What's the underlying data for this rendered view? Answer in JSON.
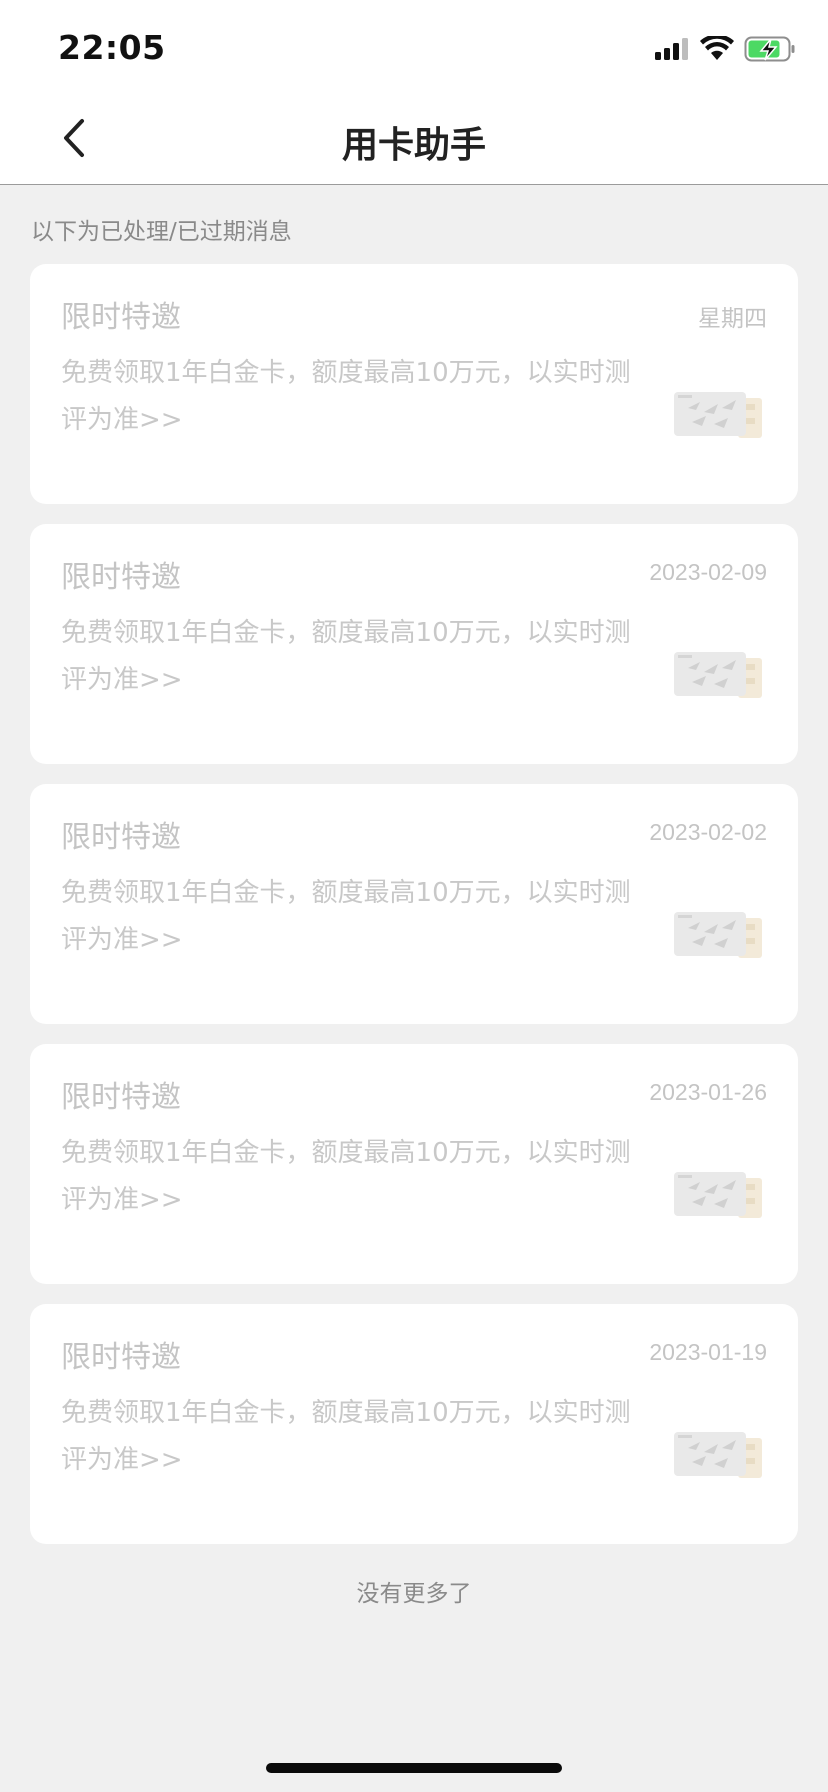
{
  "status_bar": {
    "time": "22:05",
    "icons": [
      "signal-icon",
      "wifi-icon",
      "battery-charging-icon"
    ],
    "battery_color": "#4cd964"
  },
  "nav": {
    "title": "用卡助手",
    "back_icon": "chevron-left-icon"
  },
  "section_note": "以下为已处理/已过期消息",
  "cards": [
    {
      "title": "限时特邀",
      "date": "星期四",
      "desc": "免费领取1年白金卡，额度最高10万元，以实时测评为准>>",
      "thumb_icon": "credit-card-image"
    },
    {
      "title": "限时特邀",
      "date": "2023-02-09",
      "desc": "免费领取1年白金卡，额度最高10万元，以实时测评为准>>",
      "thumb_icon": "credit-card-image"
    },
    {
      "title": "限时特邀",
      "date": "2023-02-02",
      "desc": "免费领取1年白金卡，额度最高10万元，以实时测评为准>>",
      "thumb_icon": "credit-card-image"
    },
    {
      "title": "限时特邀",
      "date": "2023-01-26",
      "desc": "免费领取1年白金卡，额度最高10万元，以实时测评为准>>",
      "thumb_icon": "credit-card-image"
    },
    {
      "title": "限时特邀",
      "date": "2023-01-19",
      "desc": "免费领取1年白金卡，额度最高10万元，以实时测评为准>>",
      "thumb_icon": "credit-card-image"
    }
  ],
  "footer_note": "没有更多了"
}
